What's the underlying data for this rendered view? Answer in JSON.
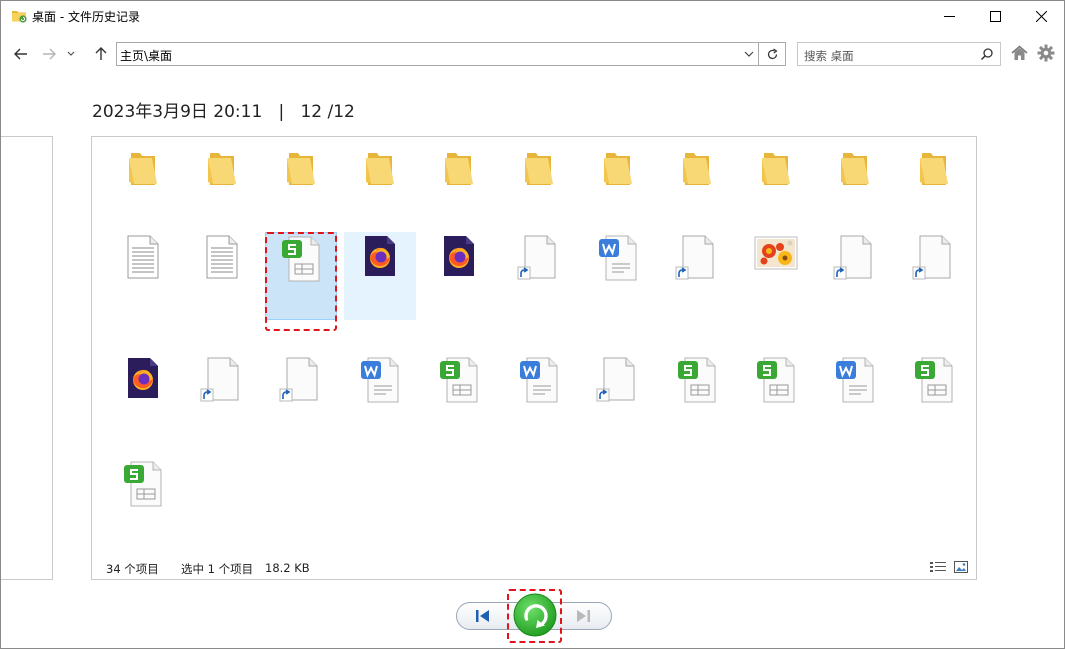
{
  "window": {
    "title": "桌面 - 文件历史记录",
    "minimize_label": "Minimize",
    "maximize_label": "Maximize",
    "close_label": "Close"
  },
  "nav": {
    "address": "主页\\桌面",
    "search_placeholder": "搜索 桌面",
    "icons": [
      "back-arrow",
      "forward-arrow",
      "recent-dropdown",
      "up-arrow",
      "refresh",
      "search",
      "home",
      "gear"
    ]
  },
  "header": {
    "datetime": "2023年3月9日 20:11",
    "separator": "|",
    "page": "12 /12"
  },
  "files": {
    "rows": [
      [
        "folder",
        "folder",
        "folder",
        "folder",
        "folder",
        "folder",
        "folder",
        "folder",
        "folder",
        "folder",
        "folder"
      ],
      [
        "text-doc",
        "text-doc",
        "wps-sheet",
        "firefox",
        "firefox",
        "shortcut",
        "wps-writer",
        "shortcut",
        "image",
        "shortcut",
        "shortcut"
      ],
      [
        "firefox",
        "shortcut",
        "shortcut",
        "wps-writer",
        "wps-sheet",
        "wps-writer",
        "shortcut",
        "wps-sheet",
        "wps-sheet",
        "wps-writer",
        "wps-sheet"
      ],
      [
        "wps-sheet"
      ]
    ],
    "selected": "row 2, item 3",
    "hovered": "row 2, item 4"
  },
  "status": {
    "count": "34 个项目",
    "selected": "选中 1 个项目",
    "size": "18.2 KB"
  },
  "controls": {
    "previous_label": "Previous version",
    "restore_label": "Restore",
    "next_label": "Next version"
  },
  "colors": {
    "selection_bg": "#cce4f7",
    "hover_bg": "#e5f3ff",
    "highlight": "#e0141b",
    "restore_green": "#2fb52f",
    "folder": "#f5c94a"
  }
}
